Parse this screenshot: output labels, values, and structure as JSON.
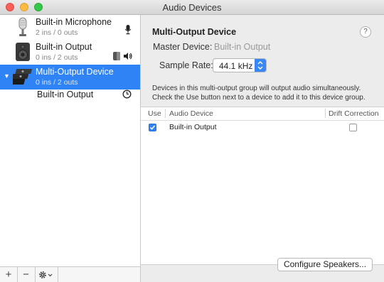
{
  "window": {
    "title": "Audio Devices"
  },
  "sidebar": {
    "devices": [
      {
        "name": "Built-in Microphone",
        "detail": "2 ins / 0 outs",
        "icon": "microphone-icon"
      },
      {
        "name": "Built-in Output",
        "detail": "0 ins / 2 outs",
        "icon": "speaker-icon"
      },
      {
        "name": "Multi-Output Device",
        "detail": "0 ins / 2 outs",
        "icon": "multi-output-icon",
        "selected": true
      }
    ],
    "subdevice": {
      "name": "Built-in Output",
      "icon": "clock-icon"
    },
    "toolbar": {
      "add": "+",
      "remove": "−"
    }
  },
  "main": {
    "title": "Multi-Output Device",
    "help": "?",
    "master_label": "Master Device:",
    "master_value": "Built-in Output",
    "rate_label": "Sample Rate:",
    "rate_value": "44.1 kHz",
    "description": "Devices in this multi-output group will output audio simultaneously. Check the Use button next to a device to add it to this device group.",
    "table": {
      "headers": {
        "use": "Use",
        "device": "Audio Device",
        "drift": "Drift Correction"
      },
      "rows": [
        {
          "use": true,
          "device": "Built-in Output",
          "drift": false
        }
      ]
    },
    "configure_label": "Configure Speakers..."
  },
  "colors": {
    "selection": "#2f83f5",
    "close": "#fc605b",
    "minimize": "#fdbc40",
    "zoom": "#34c84a"
  }
}
